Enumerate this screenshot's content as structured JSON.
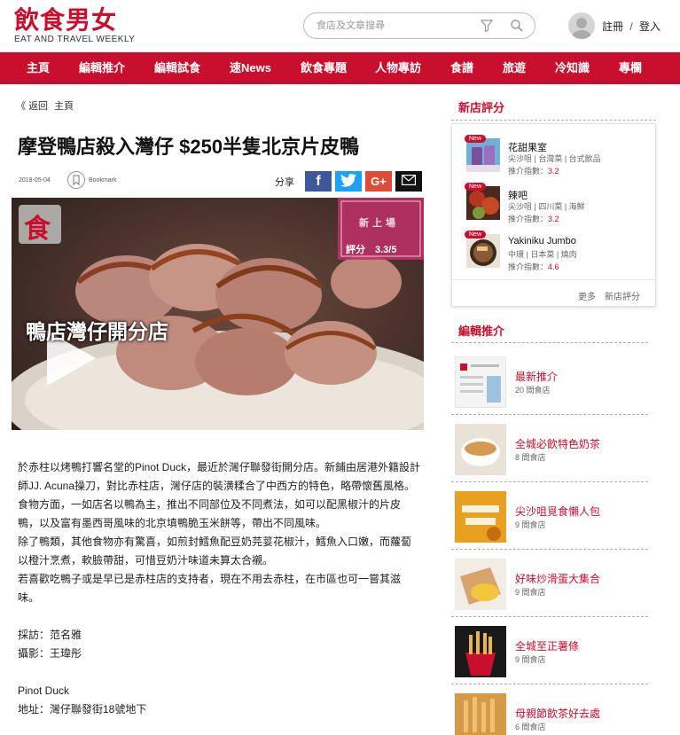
{
  "header": {
    "logo_cn": "飲食男女",
    "logo_en": "EAT AND TRAVEL WEEKLY",
    "search_placeholder": "食店及文章搜尋",
    "register": "註冊",
    "separator": "/",
    "login": "登入"
  },
  "nav": [
    "主頁",
    "編輯推介",
    "編輯試食",
    "速News",
    "飲食專題",
    "人物專訪",
    "食譜",
    "旅遊",
    "冷知識",
    "專欄"
  ],
  "breadcrumb": {
    "back": "返回",
    "home": "主頁"
  },
  "article": {
    "title": "摩登鴨店殺入灣仔 $250半隻北京片皮鴨",
    "date": "2018-05-04",
    "bookmark": "Bookmark",
    "share": "分享",
    "video_overlay": "鴨店灣仔開分店",
    "video_badge_top": "新上場",
    "video_badge_score": "評分　3.3/5",
    "video_logo": "食",
    "paragraphs": [
      "於赤柱以烤鴨打響名堂的Pinot Duck，最近於灣仔聯發街開分店。新鋪由居港外籍設計師JJ. Acuna操刀，對比赤柱店，灣仔店的裝潢糅合了中西方的特色，略帶懷舊風格。",
      "食物方面，一如店名以鴨為主，推出不同部位及不同煮法，如可以配黑椒汁的片皮鴨，以及富有墨西哥風味的北京填鴨脆玉米餅等，帶出不同風味。",
      "除了鴨類，其他食物亦有驚喜，如煎封鱈魚配豆奶芫荽花椒汁，鱈魚入口嫩，而蘿蔔以橙汁烹煮，軟臉帶甜，可惜豆奶汁味道未算太合襯。",
      "若喜歡吃鴨子或是早已是赤柱店的支持者，現在不用去赤柱，在市區也可一嘗其滋味。",
      "",
      "採訪：范名雅",
      "攝影：王瑋彤",
      "",
      "Pinot Duck",
      "地址：灣仔聯發街18號地下"
    ]
  },
  "sidebar": {
    "new_restaurants_title": "新店評分",
    "new_label": "New",
    "score_label": "推介指數：",
    "restaurants": [
      {
        "name": "花甜果室",
        "meta": "尖沙咀 | 台灣菜 | 台式飲品",
        "score": "3.2"
      },
      {
        "name": "辣吧",
        "meta": "尖沙咀 | 四川菜 | 海鮮",
        "score": "3.2"
      },
      {
        "name": "Yakiniku Jumbo",
        "meta": "中環 | 日本菜 | 燒肉",
        "score": "4.6"
      }
    ],
    "more": "更多　新店評分",
    "editor_title": "編輯推介",
    "editor_items": [
      {
        "name": "最新推介",
        "count": "20 間食店"
      },
      {
        "name": "全城必飲特色奶茶",
        "count": "8 間食店"
      },
      {
        "name": "尖沙咀覓食懶人包",
        "count": "9 間食店"
      },
      {
        "name": "好味炒滑蛋大集合",
        "count": "9 間食店"
      },
      {
        "name": "全城至正薯條",
        "count": "9 間食店"
      },
      {
        "name": "母親節飲茶好去處",
        "count": "6 間食店"
      }
    ]
  },
  "colors": {
    "brand": "#c8102e",
    "facebook": "#3b5998",
    "twitter": "#1da1f2",
    "google": "#dd4b39"
  }
}
